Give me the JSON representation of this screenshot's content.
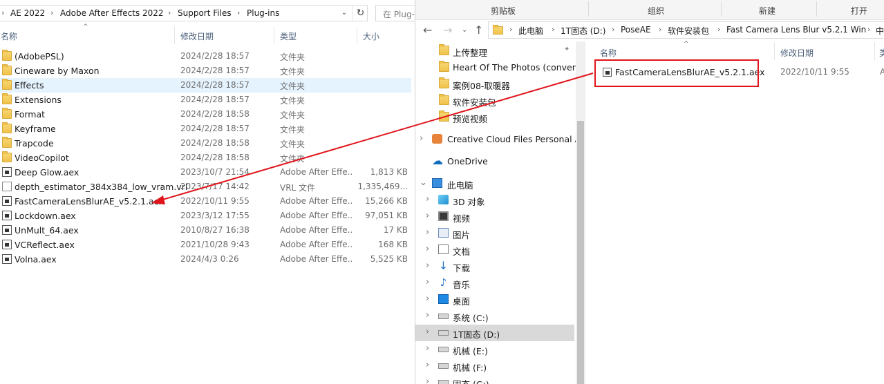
{
  "left_window": {
    "breadcrumb": [
      "AE 2022",
      "Adobe After Effects 2022",
      "Support Files",
      "Plug-ins"
    ],
    "search_placeholder": "在 Plug-",
    "columns": {
      "name": "名称",
      "date": "修改日期",
      "type": "类型",
      "size": "大小"
    },
    "rows": [
      {
        "name": "(AdobePSL)",
        "date": "2024/2/28 18:57",
        "type": "文件夹",
        "size": "",
        "icon": "folder"
      },
      {
        "name": "Cineware by Maxon",
        "date": "2024/2/28 18:57",
        "type": "文件夹",
        "size": "",
        "icon": "folder"
      },
      {
        "name": "Effects",
        "date": "2024/2/28 18:57",
        "type": "文件夹",
        "size": "",
        "icon": "folder"
      },
      {
        "name": "Extensions",
        "date": "2024/2/28 18:57",
        "type": "文件夹",
        "size": "",
        "icon": "folder"
      },
      {
        "name": "Format",
        "date": "2024/2/28 18:58",
        "type": "文件夹",
        "size": "",
        "icon": "folder"
      },
      {
        "name": "Keyframe",
        "date": "2024/2/28 18:57",
        "type": "文件夹",
        "size": "",
        "icon": "folder"
      },
      {
        "name": "Trapcode",
        "date": "2024/2/28 18:58",
        "type": "文件夹",
        "size": "",
        "icon": "folder"
      },
      {
        "name": "VideoCopilot",
        "date": "2024/2/28 18:58",
        "type": "文件夹",
        "size": "",
        "icon": "folder"
      },
      {
        "name": "Deep Glow.aex",
        "date": "2023/10/7 21:54",
        "type": "Adobe After Effe...",
        "size": "1,813 KB",
        "icon": "aex"
      },
      {
        "name": "depth_estimator_384x384_low_vram.vrl",
        "date": "2023/7/17 14:42",
        "type": "VRL 文件",
        "size": "1,335,469...",
        "icon": "file"
      },
      {
        "name": "FastCameraLensBlurAE_v5.2.1.aex",
        "date": "2022/10/11 9:55",
        "type": "Adobe After Effe...",
        "size": "15,266 KB",
        "icon": "aex"
      },
      {
        "name": "Lockdown.aex",
        "date": "2023/3/12 17:55",
        "type": "Adobe After Effe...",
        "size": "97,051 KB",
        "icon": "aex"
      },
      {
        "name": "UnMult_64.aex",
        "date": "2010/8/27 16:38",
        "type": "Adobe After Effe...",
        "size": "17 KB",
        "icon": "aex"
      },
      {
        "name": "VCReflect.aex",
        "date": "2021/10/28 9:43",
        "type": "Adobe After Effe...",
        "size": "168 KB",
        "icon": "aex"
      },
      {
        "name": "Volna.aex",
        "date": "2024/4/3 0:26",
        "type": "Adobe After Effe...",
        "size": "5,525 KB",
        "icon": "aex"
      }
    ],
    "selected_row": 2
  },
  "right_window": {
    "ribbon": [
      "剪贴板",
      "组织",
      "新建",
      "打开"
    ],
    "breadcrumb": [
      "此电脑",
      "1T固态 (D:)",
      "PoseAE",
      "软件安装包",
      "Fast Camera Lens Blur v5.2.1 Win",
      "中"
    ],
    "tree": [
      {
        "label": "上传整理",
        "icon": "folder",
        "pinned": true
      },
      {
        "label": "Heart Of The Photos (converte",
        "icon": "folder"
      },
      {
        "label": "案例08-取暖器",
        "icon": "folder"
      },
      {
        "label": "软件安装包",
        "icon": "folder"
      },
      {
        "label": "预览视频",
        "icon": "folder"
      },
      {
        "label": "Creative Cloud Files Personal Ac",
        "icon": "cc",
        "chevron": "right"
      },
      {
        "label": "OneDrive",
        "icon": "cloud"
      },
      {
        "label": "此电脑",
        "icon": "pc",
        "chevron": "down"
      },
      {
        "label": "3D 对象",
        "icon": "cube",
        "chevron": "right"
      },
      {
        "label": "视频",
        "icon": "film",
        "chevron": "right"
      },
      {
        "label": "图片",
        "icon": "pic",
        "chevron": "right"
      },
      {
        "label": "文档",
        "icon": "doc",
        "chevron": "right"
      },
      {
        "label": "下载",
        "icon": "down",
        "chevron": "right"
      },
      {
        "label": "音乐",
        "icon": "music",
        "chevron": "right"
      },
      {
        "label": "桌面",
        "icon": "desk",
        "chevron": "right"
      },
      {
        "label": "系统 (C:)",
        "icon": "drv",
        "chevron": "right"
      },
      {
        "label": "1T固态 (D:)",
        "icon": "drv",
        "chevron": "right",
        "selected": true
      },
      {
        "label": "机械 (E:)",
        "icon": "drv",
        "chevron": "right"
      },
      {
        "label": "机械 (F:)",
        "icon": "drv",
        "chevron": "right"
      },
      {
        "label": "固态 (G:)",
        "icon": "drv",
        "chevron": "right"
      }
    ],
    "columns": {
      "name": "名称",
      "date": "修改日期",
      "type": "类"
    },
    "file": {
      "name": "FastCameraLensBlurAE_v5.2.1.aex",
      "date": "2022/10/11 9:55",
      "type": "A"
    }
  },
  "annotation": {
    "color": "#e0141a"
  }
}
